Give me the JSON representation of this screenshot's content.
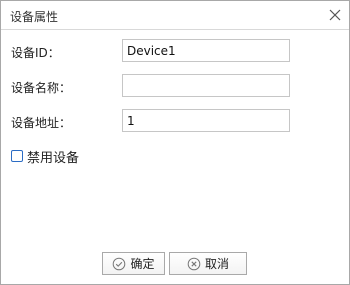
{
  "dialog": {
    "title": "设备属性",
    "close_icon": "close-icon"
  },
  "form": {
    "device_id": {
      "label": "设备ID：",
      "value": "Device1",
      "placeholder": ""
    },
    "device_name": {
      "label": "设备名称：",
      "value": "",
      "placeholder": ""
    },
    "device_address": {
      "label": "设备地址：",
      "value": "1",
      "placeholder": ""
    },
    "disable_device": {
      "label": "禁用设备",
      "checked": false
    }
  },
  "footer": {
    "ok_label": "确定",
    "ok_icon": "check-circle-icon",
    "cancel_label": "取消",
    "cancel_icon": "x-circle-icon"
  },
  "colors": {
    "checkbox_border": "#2b6cc4",
    "border": "#a8a8a8"
  }
}
